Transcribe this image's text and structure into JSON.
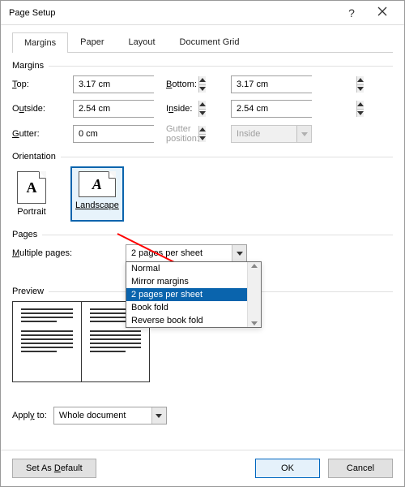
{
  "title": "Page Setup",
  "tabs": [
    "Margins",
    "Paper",
    "Layout",
    "Document Grid"
  ],
  "active_tab": 0,
  "margins": {
    "heading": "Margins",
    "top_label": "Top:",
    "top_value": "3.17 cm",
    "bottom_label": "Bottom:",
    "bottom_value": "3.17 cm",
    "outside_label": "Outside:",
    "outside_value": "2.54 cm",
    "inside_label": "Inside:",
    "inside_value": "2.54 cm",
    "gutter_label": "Gutter:",
    "gutter_value": "0 cm",
    "gutter_pos_label": "Gutter position:",
    "gutter_pos_value": "Inside"
  },
  "orientation": {
    "heading": "Orientation",
    "portrait": "Portrait",
    "landscape": "Landscape",
    "selected": "landscape"
  },
  "pages": {
    "heading": "Pages",
    "label": "Multiple pages:",
    "value": "2 pages per sheet",
    "options": [
      "Normal",
      "Mirror margins",
      "2 pages per sheet",
      "Book fold",
      "Reverse book fold"
    ],
    "selected_index": 2
  },
  "preview": {
    "heading": "Preview"
  },
  "apply": {
    "label": "Apply to:",
    "value": "Whole document"
  },
  "footer": {
    "default_btn": "Set As Default",
    "ok": "OK",
    "cancel": "Cancel"
  }
}
